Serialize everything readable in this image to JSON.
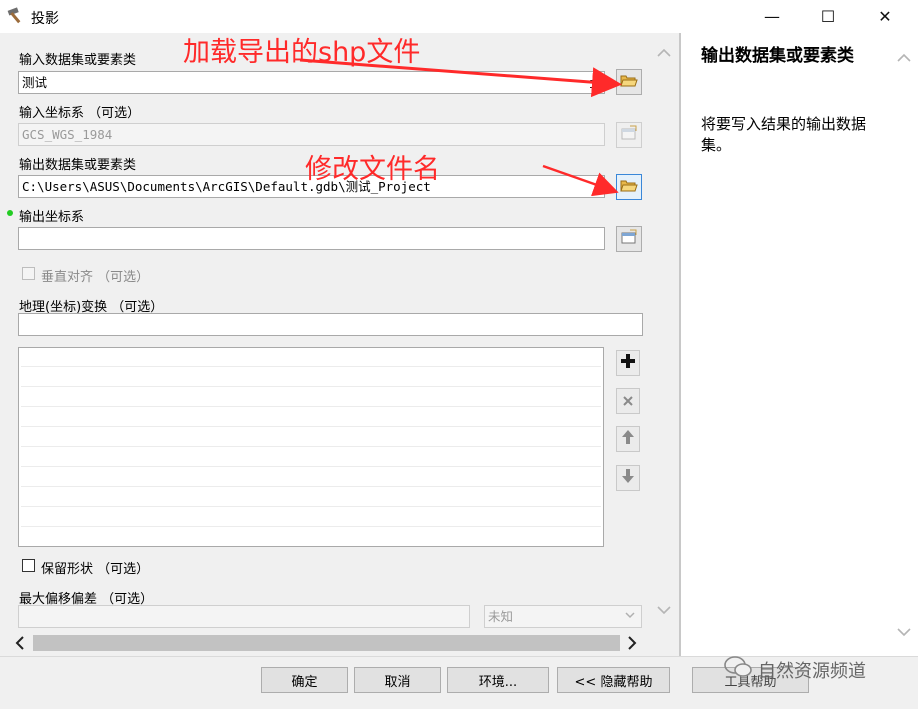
{
  "window": {
    "title": "投影",
    "minimize": "—",
    "maximize": "☐",
    "close": "✕"
  },
  "form": {
    "input_dataset_label": "输入数据集或要素类",
    "input_dataset_value": "测试",
    "input_crs_label": "输入坐标系 （可选）",
    "input_crs_value": "GCS_WGS_1984",
    "output_dataset_label": "输出数据集或要素类",
    "output_dataset_value": "C:\\Users\\ASUS\\Documents\\ArcGIS\\Default.gdb\\测试_Project",
    "output_crs_label": "输出坐标系",
    "output_crs_value": "",
    "vertical_label": "垂直对齐 （可选）",
    "geo_transform_label": "地理(坐标)变换 （可选）",
    "geo_transform_value": "",
    "preserve_shape_label": "保留形状 （可选）",
    "max_offset_label": "最大偏移偏差 （可选）",
    "max_offset_value": "",
    "max_offset_unit": "未知"
  },
  "annotations": {
    "load_export": "加载导出的shp文件",
    "rename": "修改文件名"
  },
  "help": {
    "title": "输出数据集或要素类",
    "body": "将要写入结果的输出数据集。"
  },
  "buttons": {
    "ok": "确定",
    "cancel": "取消",
    "env": "环境...",
    "hide_help": "<< 隐藏帮助",
    "tool_help": "工具帮助"
  },
  "watermark": "自然资源频道",
  "colors": {
    "annotation": "#ff2a2a",
    "required_dot": "#22cc22",
    "focus_border": "#3a87d8"
  }
}
